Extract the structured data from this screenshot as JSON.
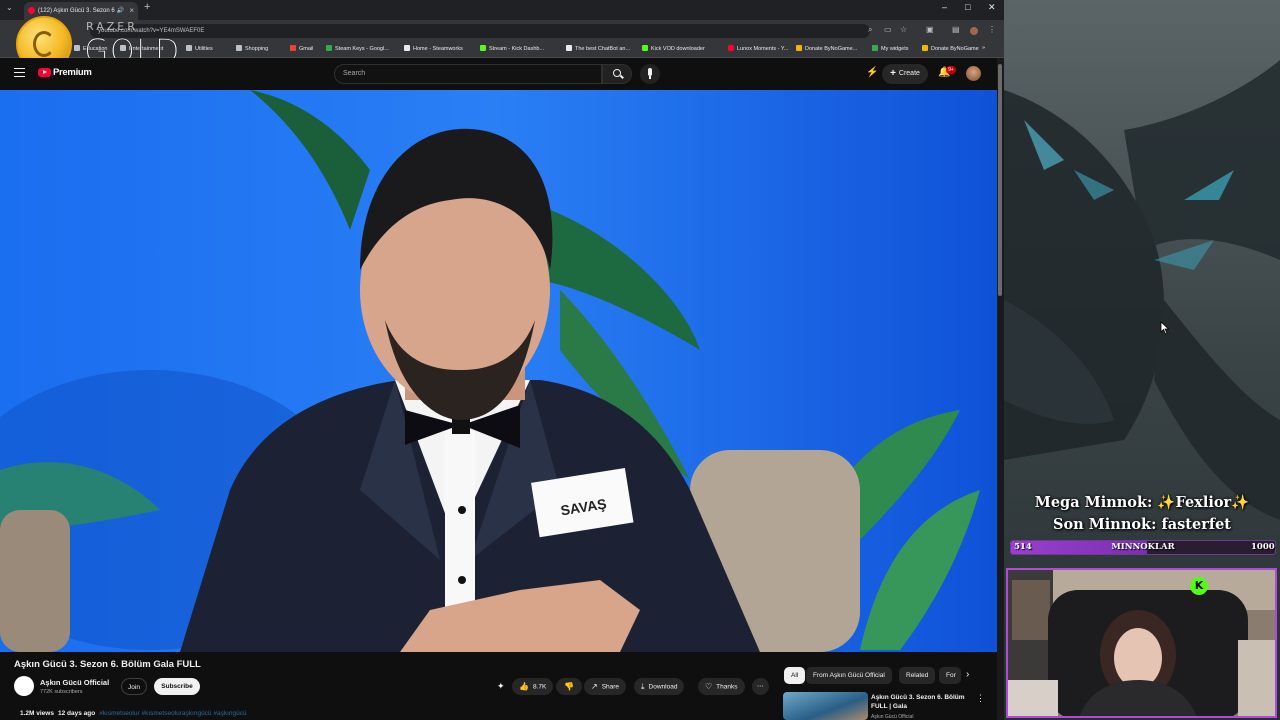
{
  "browser": {
    "tab_title": "(122) Aşkın Gücü 3. Sezon 6",
    "url": "youtube.com/watch?v=YE4mSWAEF0E",
    "bookmarks": [
      {
        "label": "Education",
        "color": "#bdc1c6"
      },
      {
        "label": "Entertainment",
        "color": "#bdc1c6"
      },
      {
        "label": "Utilities",
        "color": "#bdc1c6"
      },
      {
        "label": "Shopping",
        "color": "#bdc1c6"
      },
      {
        "label": "Gmail",
        "color": "#ea4335"
      },
      {
        "label": "Steam Keys - Googl...",
        "color": "#34a853"
      },
      {
        "label": "Home - Steamworks",
        "color": "#e8eaed"
      },
      {
        "label": "Stream - Kick Dashb...",
        "color": "#53fc18"
      },
      {
        "label": "The best ChatBot an...",
        "color": "#e8eaed"
      },
      {
        "label": "Kick VOD downloader",
        "color": "#53fc18"
      },
      {
        "label": "Lunox Moments - Y...",
        "color": "#ff0033"
      },
      {
        "label": "Donate ByNoGame...",
        "color": "#f5b400"
      },
      {
        "label": "My widgets",
        "color": "#34a853"
      },
      {
        "label": "Donate ByNoGame",
        "color": "#f5b400"
      }
    ]
  },
  "overlay": {
    "razer_label": "RAZER",
    "gold_label": "GOLD"
  },
  "youtube": {
    "brand": "Premium",
    "search_placeholder": "Search",
    "create_label": "Create",
    "notification_count": "9+"
  },
  "video": {
    "name_card": "SAVAŞ",
    "title": "Aşkın Gücü 3. Sezon 6. Bölüm Gala FULL",
    "channel_name": "Aşkın Gücü Official",
    "subscribers": "772K subscribers",
    "join_label": "Join",
    "subscribe_label": "Subscribe",
    "likes": "8.7K",
    "share_label": "Share",
    "download_label": "Download",
    "thanks_label": "Thanks",
    "views": "1.2M views",
    "age": "12 days ago",
    "tags": "#kısmetseolur #kısmetseoluraşkıngücü #aşkıngücü"
  },
  "sidebar": {
    "chips": [
      "All",
      "From Aşkın Gücü Official",
      "Related",
      "For"
    ],
    "related": {
      "title": "Aşkın Gücü 3. Sezon 6. Bölüm FULL | Gala",
      "channel": "Aşkın Gücü Official"
    }
  },
  "stream": {
    "mega_minnok": "Mega Minnok: ✨Fexlior✨",
    "son_minnok": "Son Minnok: fasterfet",
    "goal_label": "MINNOKLAR",
    "goal_current": "514",
    "goal_target": "1000",
    "goal_progress": 0.514,
    "kick_letter": "K"
  },
  "colors": {
    "accent_purple": "#9a3fd0",
    "youtube_red": "#ff0033",
    "kick_green": "#53fc18"
  }
}
